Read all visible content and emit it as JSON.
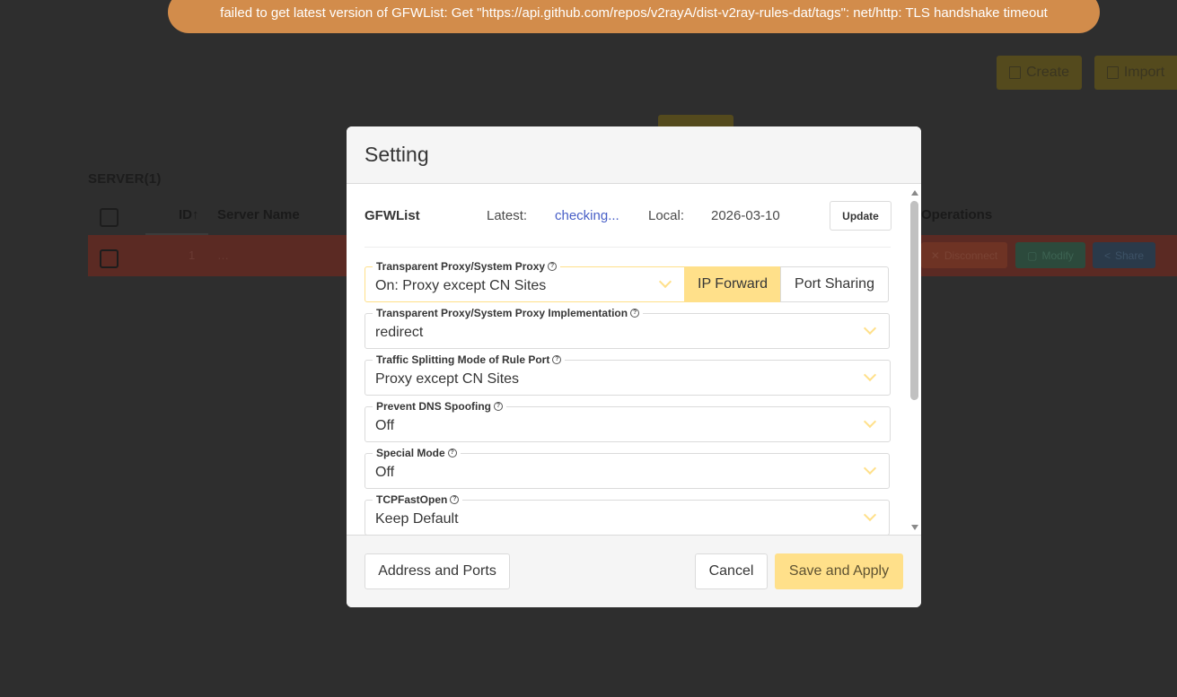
{
  "toast": {
    "message": "failed to get latest version of GFWList: Get \"https://api.github.com/repos/v2rayA/dist-v2ray-rules-dat/tags\": net/http: TLS handshake timeout",
    "color": "#d28c4b"
  },
  "background": {
    "create_label": "Create",
    "import_label": "Import",
    "server_section_title": "SERVER(1)",
    "columns": {
      "id": "ID",
      "sort_icon": "↑",
      "server_name": "Server Name",
      "operations": "Operations"
    },
    "row": {
      "id": "1",
      "name": "…",
      "disconnect_label": "Disconnect",
      "modify_label": "Modify",
      "share_label": "Share"
    }
  },
  "modal": {
    "title": "Setting",
    "gfwlist": {
      "title": "GFWList",
      "latest_label": "Latest:",
      "latest_value": "checking...",
      "local_label": "Local:",
      "local_value": "2026-03-10",
      "update_label": "Update"
    },
    "fields": {
      "transparent_proxy": {
        "label": "Transparent Proxy/System Proxy",
        "value": "On: Proxy except CN Sites",
        "ip_forward_label": "IP Forward",
        "port_sharing_label": "Port Sharing"
      },
      "implementation": {
        "label": "Transparent Proxy/System Proxy Implementation",
        "value": "redirect"
      },
      "splitting": {
        "label": "Traffic Splitting Mode of Rule Port",
        "value": "Proxy except CN Sites"
      },
      "dns_spoofing": {
        "label": "Prevent DNS Spoofing",
        "value": "Off"
      },
      "special_mode": {
        "label": "Special Mode",
        "value": "Off"
      },
      "tcp_fast_open": {
        "label": "TCPFastOpen",
        "value": "Keep Default"
      }
    },
    "footer": {
      "address_ports_label": "Address and Ports",
      "cancel_label": "Cancel",
      "save_apply_label": "Save and Apply"
    },
    "accent_color": "#ffe08a"
  }
}
